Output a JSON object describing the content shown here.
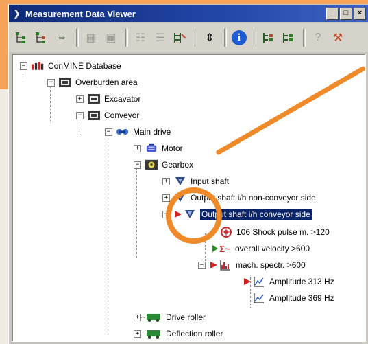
{
  "window": {
    "title": "Measurement Data Viewer",
    "controls": [
      "_",
      "□",
      "×"
    ]
  },
  "toolbar": {
    "groups": [
      [
        "tree-add-icon",
        "tree-branch-icon",
        "swap-arrows-icon"
      ],
      [
        "grid-icon",
        "dialog-icon"
      ],
      [
        "list-icon",
        "list-alt-icon",
        "hierarchy-icon"
      ],
      [
        "arrows-vertical-icon"
      ],
      [
        "info-icon"
      ],
      [
        "tree-left-icon",
        "tree-right-icon"
      ],
      [
        "help-icon",
        "tool-icon"
      ]
    ]
  },
  "tree": {
    "nodes": [
      {
        "label": "ConMINE Database",
        "expander": "−"
      },
      {
        "label": "Overburden area",
        "expander": "−"
      },
      {
        "label": "Excavator",
        "expander": "+"
      },
      {
        "label": "Conveyor",
        "expander": "−"
      },
      {
        "label": "Main drive",
        "expander": "−"
      },
      {
        "label": "Motor",
        "expander": "+"
      },
      {
        "label": "Gearbox",
        "expander": "−"
      },
      {
        "label": "Input shaft",
        "expander": "+"
      },
      {
        "label": "Output shaft i/h non-conveyor side",
        "expander": "+"
      },
      {
        "label": "Output shaft i/h conveyor side",
        "expander": "−",
        "selected": true
      },
      {
        "label": "106 Shock pulse m. >120",
        "expander": ""
      },
      {
        "label": "overall velocity >600",
        "expander": ""
      },
      {
        "label": "mach. spectr. >600",
        "expander": "−"
      },
      {
        "label": "Amplitude 313 Hz",
        "expander": ""
      },
      {
        "label": "Amplitude 369 Hz",
        "expander": ""
      },
      {
        "label": "Drive roller",
        "expander": "+"
      },
      {
        "label": "Deflection roller",
        "expander": "+"
      }
    ]
  },
  "colors": {
    "accent_orange": "#ef8a2a",
    "selection": "#0a246a",
    "titlebar": "#0e2a78",
    "alarm_red": "#d0231f",
    "ok_green": "#2a8a2a"
  }
}
